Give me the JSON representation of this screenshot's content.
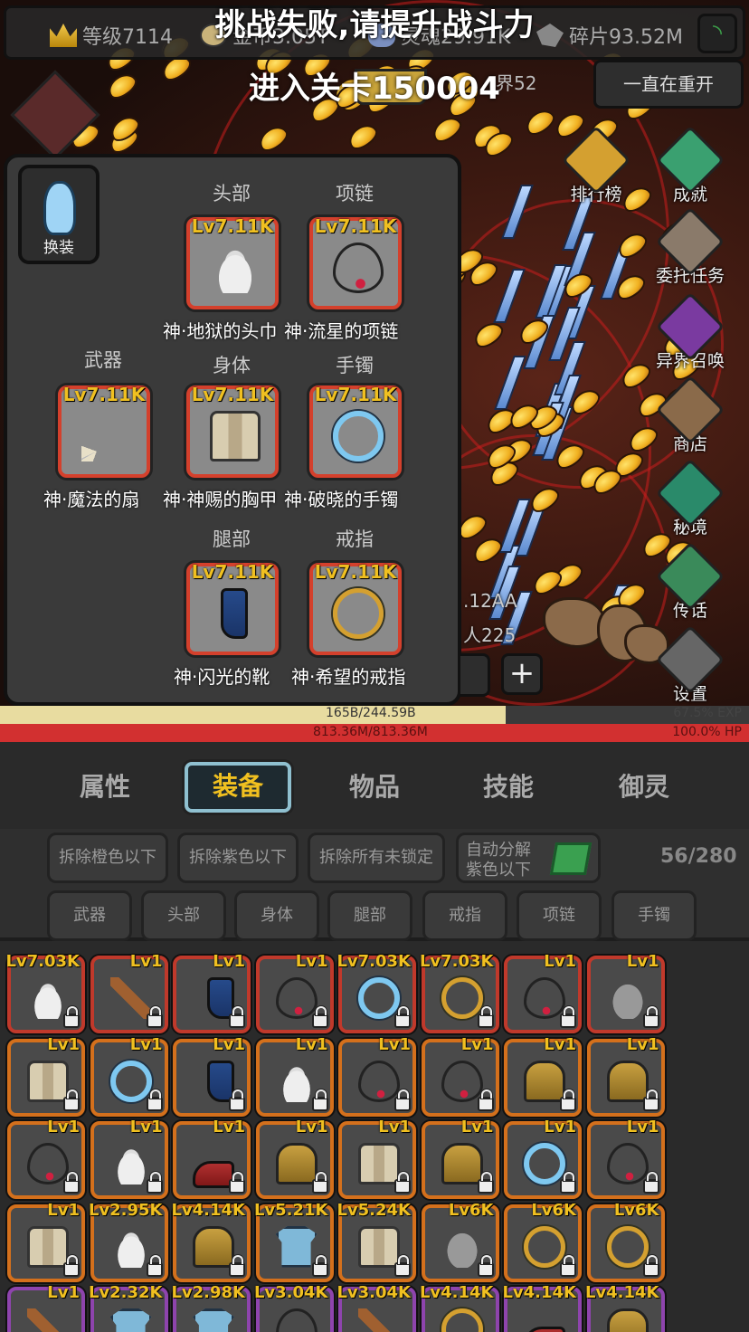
{
  "topbar": {
    "level": "等级7114",
    "gold": "金币3.05T",
    "soul": "灵魂29.91K",
    "shards": "碎片93.52M"
  },
  "notice": "挑战失败,请提升战斗力",
  "stage_label": "进入关卡150004",
  "realm": "界52",
  "restart_label": "一直在重开",
  "right_menu": [
    {
      "label": "排行榜",
      "color": "#d4a030"
    },
    {
      "label": "成就",
      "color": "#3aa070"
    },
    {
      "label": "委托任务",
      "color": "#8a7a6a"
    },
    {
      "label": "异界召唤",
      "color": "#7a3aa0"
    },
    {
      "label": "商店",
      "color": "#8a6a4a"
    },
    {
      "label": "秘境",
      "color": "#2a8a6a"
    },
    {
      "label": "传话",
      "color": "#3a8a5a"
    },
    {
      "label": "设置",
      "color": "#666666"
    }
  ],
  "equip": {
    "change_label": "换装",
    "slots": {
      "head": {
        "title": "头部",
        "level": "Lv7.11K",
        "name": "神·地狱的头巾"
      },
      "neck": {
        "title": "项链",
        "level": "Lv7.11K",
        "name": "神·流星的项链"
      },
      "weapon": {
        "title": "武器",
        "level": "Lv7.11K",
        "name": "神·魔法的扇"
      },
      "body": {
        "title": "身体",
        "level": "Lv7.11K",
        "name": "神·神赐的胸甲"
      },
      "bracelet": {
        "title": "手镯",
        "level": "Lv7.11K",
        "name": "神·破晓的手镯"
      },
      "legs": {
        "title": "腿部",
        "level": "Lv7.11K",
        "name": "神·闪光的靴"
      },
      "ring": {
        "title": "戒指",
        "level": "Lv7.11K",
        "name": "神·希望的戒指"
      }
    }
  },
  "battle": {
    "damage": ".12AA",
    "enemies": "人225"
  },
  "exp": {
    "text": "165B/244.59B",
    "percent": "67.5% EXP",
    "fill": 0.675
  },
  "hp": {
    "text": "813.36M/813.36M",
    "percent": "100.0%  HP"
  },
  "tabs": [
    "属性",
    "装备",
    "物品",
    "技能",
    "御灵"
  ],
  "actions": {
    "remove_orange": "拆除橙色以下",
    "remove_purple": "拆除紫色以下",
    "remove_unlocked": "拆除所有未锁定",
    "auto_decompose": "自动分解",
    "auto_decompose_sub": "紫色以下",
    "bag_count": "56/280"
  },
  "filters": [
    "武器",
    "头部",
    "身体",
    "腿部",
    "戒指",
    "项链",
    "手镯"
  ],
  "inventory": [
    [
      {
        "lv": "Lv7.03K",
        "art": "hat",
        "rarity": "red"
      },
      {
        "lv": "Lv1",
        "art": "wand",
        "rarity": "red"
      },
      {
        "lv": "Lv1",
        "art": "boot",
        "rarity": "red"
      },
      {
        "lv": "Lv1",
        "art": "neck",
        "rarity": "red"
      },
      {
        "lv": "Lv7.03K",
        "art": "bracelet",
        "rarity": "red"
      },
      {
        "lv": "Lv7.03K",
        "art": "ring",
        "rarity": "red"
      },
      {
        "lv": "Lv1",
        "art": "neck",
        "rarity": "red"
      },
      {
        "lv": "Lv1",
        "art": "helm",
        "rarity": "red"
      }
    ],
    [
      {
        "lv": "Lv1",
        "art": "vest",
        "rarity": "orange"
      },
      {
        "lv": "Lv1",
        "art": "bracelet",
        "rarity": "orange"
      },
      {
        "lv": "Lv1",
        "art": "boot",
        "rarity": "orange"
      },
      {
        "lv": "Lv1",
        "art": "hat",
        "rarity": "orange"
      },
      {
        "lv": "Lv1",
        "art": "neck",
        "rarity": "orange"
      },
      {
        "lv": "Lv1",
        "art": "neck",
        "rarity": "orange"
      },
      {
        "lv": "Lv1",
        "art": "armor",
        "rarity": "orange"
      },
      {
        "lv": "Lv1",
        "art": "armor",
        "rarity": "orange"
      }
    ],
    [
      {
        "lv": "Lv1",
        "art": "neck",
        "rarity": "orange"
      },
      {
        "lv": "Lv1",
        "art": "hat",
        "rarity": "orange"
      },
      {
        "lv": "Lv1",
        "art": "shoe",
        "rarity": "orange"
      },
      {
        "lv": "Lv1",
        "art": "armor",
        "rarity": "orange"
      },
      {
        "lv": "Lv1",
        "art": "vest",
        "rarity": "orange"
      },
      {
        "lv": "Lv1",
        "art": "armor",
        "rarity": "orange"
      },
      {
        "lv": "Lv1",
        "art": "bracelet",
        "rarity": "orange"
      },
      {
        "lv": "Lv1",
        "art": "neck",
        "rarity": "orange"
      }
    ],
    [
      {
        "lv": "Lv1",
        "art": "vest",
        "rarity": "orange"
      },
      {
        "lv": "Lv2.95K",
        "art": "hat",
        "rarity": "orange"
      },
      {
        "lv": "Lv4.14K",
        "art": "armor",
        "rarity": "orange"
      },
      {
        "lv": "Lv5.21K",
        "art": "shirt",
        "rarity": "orange"
      },
      {
        "lv": "Lv5.24K",
        "art": "vest",
        "rarity": "orange"
      },
      {
        "lv": "Lv6K",
        "art": "helm",
        "rarity": "orange"
      },
      {
        "lv": "Lv6K",
        "art": "ring",
        "rarity": "orange"
      },
      {
        "lv": "Lv6K",
        "art": "ring",
        "rarity": "orange"
      }
    ],
    [
      {
        "lv": "Lv1",
        "art": "wand",
        "rarity": "purple"
      },
      {
        "lv": "Lv2.32K",
        "art": "shirt",
        "rarity": "purple"
      },
      {
        "lv": "Lv2.98K",
        "art": "shirt",
        "rarity": "purple"
      },
      {
        "lv": "Lv3.04K",
        "art": "neck",
        "rarity": "purple"
      },
      {
        "lv": "Lv3.04K",
        "art": "wand",
        "rarity": "purple"
      },
      {
        "lv": "Lv4.14K",
        "art": "ring",
        "rarity": "purple"
      },
      {
        "lv": "Lv4.14K",
        "art": "shoe",
        "rarity": "purple"
      },
      {
        "lv": "Lv4.14K",
        "art": "armor",
        "rarity": "purple"
      }
    ]
  ]
}
